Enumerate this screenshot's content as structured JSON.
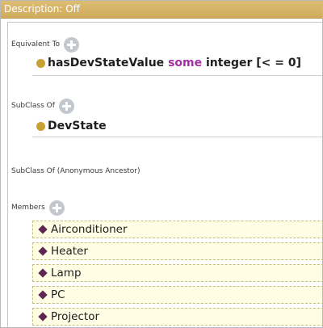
{
  "title_bar": {
    "text": "Description: Off"
  },
  "sections": {
    "equivalent_to": {
      "label": "Equivalent To",
      "expression": {
        "property": "hasDevStateValue",
        "keyword": "some",
        "rest": "integer [< = 0]"
      }
    },
    "subclass_of": {
      "label": "SubClass Of",
      "item": "DevState"
    },
    "anonymous_ancestor": {
      "label": "SubClass Of (Anonymous Ancestor)"
    },
    "members": {
      "label": "Members",
      "items": [
        "Airconditioner",
        "Heater",
        "Lamp",
        "PC",
        "Projector"
      ]
    }
  },
  "icons": {
    "add": "add-circle-icon",
    "class": "class-dot-icon",
    "individual": "individual-diamond-icon"
  },
  "colors": {
    "title_bar": "#d6b467",
    "class_dot": "#c9a133",
    "keyword": "#a42ea4",
    "individual_diamond": "#5d2751",
    "member_row_bg": "#fffde3"
  }
}
